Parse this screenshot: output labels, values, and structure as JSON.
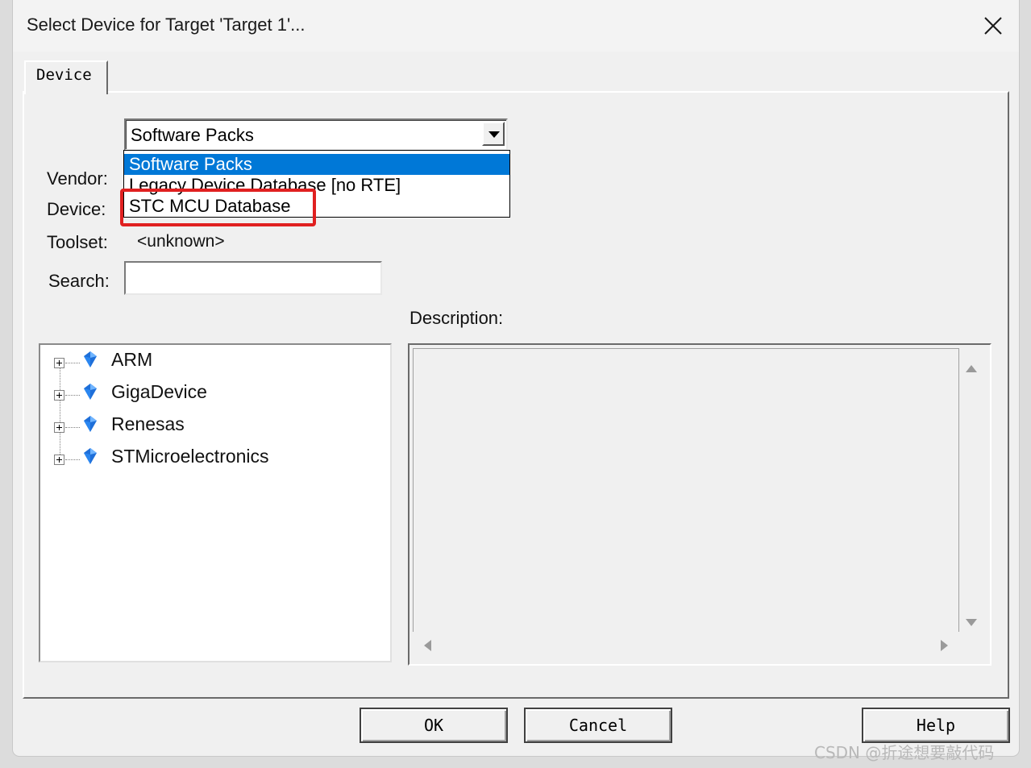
{
  "window": {
    "title": "Select Device for Target 'Target 1'..."
  },
  "tabs": [
    {
      "label": "Device"
    }
  ],
  "labels": {
    "vendor": "Vendor:",
    "device": "Device:",
    "toolset": "Toolset:",
    "toolset_value": "<unknown>",
    "search": "Search:",
    "description": "Description:"
  },
  "database_combo": {
    "selected": "Software Packs",
    "options": [
      "Software Packs",
      "Legacy Device Database [no RTE]",
      "STC MCU Database"
    ],
    "highlighted_option": "STC MCU Database"
  },
  "search": {
    "value": ""
  },
  "vendor_tree": {
    "items": [
      {
        "label": "ARM"
      },
      {
        "label": "GigaDevice"
      },
      {
        "label": "Renesas"
      },
      {
        "label": "STMicroelectronics"
      }
    ]
  },
  "buttons": {
    "ok": "OK",
    "cancel": "Cancel",
    "help": "Help"
  },
  "watermark": "CSDN @折途想要敲代码",
  "colors": {
    "selection": "#0078d7",
    "annotation_box": "#e02020"
  }
}
